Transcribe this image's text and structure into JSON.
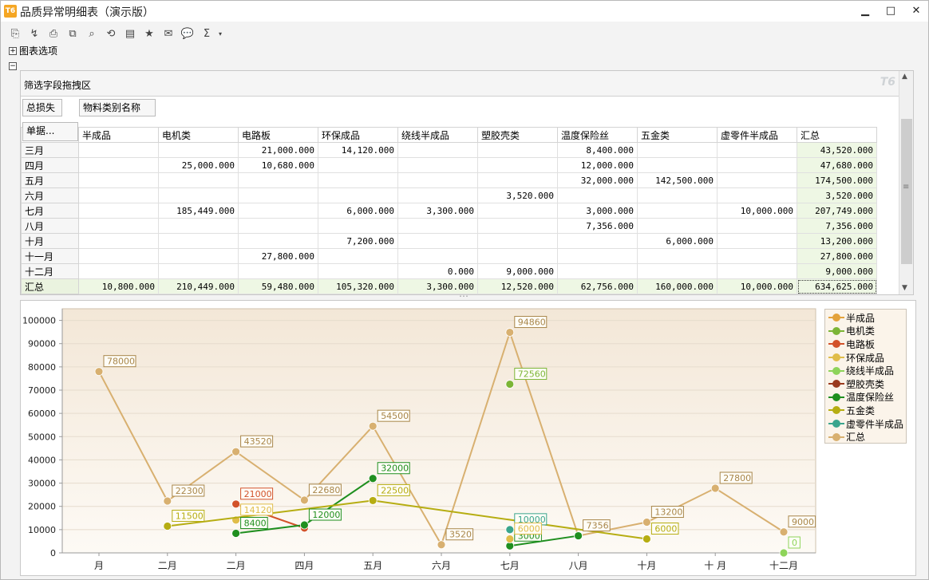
{
  "window": {
    "title": "品质异常明细表（演示版）",
    "app_icon_text": "T6",
    "minimize": "▁",
    "maximize": "□",
    "close": "✕"
  },
  "toolbar": {
    "buttons": [
      {
        "name": "print-setup-icon",
        "glyph": "⎘"
      },
      {
        "name": "refresh-data-icon",
        "glyph": "↯"
      },
      {
        "name": "print-icon",
        "glyph": "⎙"
      },
      {
        "name": "preview-icon",
        "glyph": "⧉"
      },
      {
        "name": "find-icon",
        "glyph": "⌕"
      },
      {
        "name": "refresh-icon",
        "glyph": "⟲"
      },
      {
        "name": "export-icon",
        "glyph": "▤"
      },
      {
        "name": "favorite-icon",
        "glyph": "★"
      },
      {
        "name": "mail-icon",
        "glyph": "✉"
      },
      {
        "name": "comment-icon",
        "glyph": "💬"
      },
      {
        "name": "sum-icon",
        "glyph": "Σ"
      }
    ],
    "dropdown_arrow": "▾"
  },
  "options": {
    "chart_options_expand": "+",
    "chart_options_label": "图表选项",
    "section_collapse": "−"
  },
  "pivot": {
    "drag_area_label": "筛选字段拖拽区",
    "logo": "T6",
    "data_field": "总损失",
    "column_field": "物料类别名称",
    "row_field": "单据...",
    "columns": [
      "半成品",
      "电机类",
      "电路板",
      "环保成品",
      "绕线半成品",
      "塑胶壳类",
      "温度保险丝",
      "五金类",
      "虚零件半成品",
      "汇总"
    ],
    "rows": [
      {
        "label": "三月",
        "cells": [
          "",
          "",
          "21,000.000",
          "14,120.000",
          "",
          "",
          "8,400.000",
          "",
          "",
          "43,520.000"
        ]
      },
      {
        "label": "四月",
        "cells": [
          "",
          "25,000.000",
          "10,680.000",
          "",
          "",
          "",
          "12,000.000",
          "",
          "",
          "47,680.000"
        ]
      },
      {
        "label": "五月",
        "cells": [
          "",
          "",
          "",
          "",
          "",
          "",
          "32,000.000",
          "142,500.000",
          "",
          "174,500.000"
        ]
      },
      {
        "label": "六月",
        "cells": [
          "",
          "",
          "",
          "",
          "",
          "3,520.000",
          "",
          "",
          "",
          "3,520.000"
        ]
      },
      {
        "label": "七月",
        "cells": [
          "",
          "185,449.000",
          "",
          "6,000.000",
          "3,300.000",
          "",
          "3,000.000",
          "",
          "10,000.000",
          "207,749.000"
        ]
      },
      {
        "label": "八月",
        "cells": [
          "",
          "",
          "",
          "",
          "",
          "",
          "7,356.000",
          "",
          "",
          "7,356.000"
        ]
      },
      {
        "label": "十月",
        "cells": [
          "",
          "",
          "",
          "7,200.000",
          "",
          "",
          "",
          "6,000.000",
          "",
          "13,200.000"
        ]
      },
      {
        "label": "十一月",
        "cells": [
          "",
          "",
          "27,800.000",
          "",
          "",
          "",
          "",
          "",
          "",
          "27,800.000"
        ]
      },
      {
        "label": "十二月",
        "cells": [
          "",
          "",
          "",
          "",
          "0.000",
          "9,000.000",
          "",
          "",
          "",
          "9,000.000"
        ]
      }
    ],
    "total_row": {
      "label": "汇总",
      "cells": [
        "10,800.000",
        "210,449.000",
        "59,480.000",
        "105,320.000",
        "3,300.000",
        "12,520.000",
        "62,756.000",
        "160,000.000",
        "10,000.000",
        "634,625.000"
      ]
    },
    "scroll_up": "▲",
    "scroll_down": "▼",
    "scroll_grip": "≡"
  },
  "splitter_grip": "⋯",
  "chart_data": {
    "type": "line",
    "categories": [
      "月",
      "二月",
      "二月",
      "四月",
      "五月",
      "六月",
      "七月",
      "八月",
      "十月",
      "十 月",
      "十二月"
    ],
    "yticks": [
      0,
      10000,
      20000,
      30000,
      40000,
      50000,
      60000,
      70000,
      80000,
      90000,
      100000
    ],
    "ylim": [
      0,
      105000
    ],
    "grid": true,
    "legend_position": "right",
    "colors": {
      "plot_bg_top": "#f3e7d7",
      "plot_bg_bottom": "#fdfaf5",
      "grid": "#e6dccd"
    },
    "series": [
      {
        "name": "半成品",
        "color": "#e3a23b",
        "points": []
      },
      {
        "name": "电机类",
        "color": "#7cb536",
        "points": []
      },
      {
        "name": "电路板",
        "color": "#d2522a",
        "points": [
          [
            2,
            21000
          ],
          [
            3,
            10680
          ]
        ],
        "labels": [
          0
        ]
      },
      {
        "name": "环保成品",
        "color": "#e0bd4a",
        "points": [
          [
            2,
            14120
          ]
        ],
        "labels": [
          0
        ]
      },
      {
        "name": "绕线半成品",
        "color": "#8ed45a",
        "points": [
          [
            10,
            0
          ]
        ],
        "labels": [
          0
        ]
      },
      {
        "name": "塑胶壳类",
        "color": "#9a3a1e",
        "points": []
      },
      {
        "name": "温度保险丝",
        "color": "#1f8f1f",
        "points": [
          [
            2,
            8400
          ],
          [
            3,
            12000
          ],
          [
            4,
            32000
          ]
        ],
        "labels": [
          0,
          1,
          2
        ]
      },
      {
        "name": "五金类",
        "color": "#b6ad12",
        "points": [
          [
            1,
            11500
          ],
          [
            4,
            22500
          ],
          [
            8,
            6000
          ]
        ],
        "labels": [
          0,
          1,
          2
        ]
      },
      {
        "name": "虚零件半成品",
        "color": "#3aa58d",
        "points": [
          [
            6,
            10000
          ]
        ],
        "labels": [
          0
        ]
      },
      {
        "name": "汇总",
        "color": "#d8b070",
        "points": [
          [
            0,
            78000
          ],
          [
            1,
            22300
          ],
          [
            2,
            43520
          ],
          [
            3,
            22680
          ],
          [
            4,
            54500
          ],
          [
            5,
            3520
          ],
          [
            6,
            94860
          ],
          [
            7,
            7356
          ],
          [
            8,
            13200
          ],
          [
            9,
            27800
          ],
          [
            10,
            9000
          ]
        ],
        "labels": [
          0,
          1,
          2,
          3,
          4,
          5,
          6,
          7,
          8,
          9,
          10
        ]
      }
    ],
    "extra_points": [
      {
        "series": "温度保险丝",
        "x": 6,
        "y": 3000,
        "label": "3000"
      },
      {
        "series": "温度保险丝",
        "x": 7,
        "y": 7356,
        "label": ""
      },
      {
        "series": "电机类",
        "x": 6,
        "y": 72560,
        "label": "72560"
      },
      {
        "series": "环保成品",
        "x": 6,
        "y": 6000,
        "label": "6000"
      }
    ]
  }
}
